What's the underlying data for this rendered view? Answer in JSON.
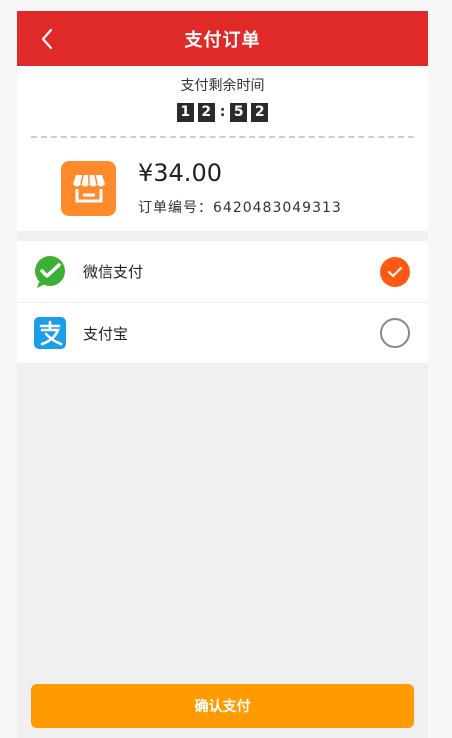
{
  "navbar": {
    "title": "支付订单",
    "back_icon": "back-icon"
  },
  "countdown": {
    "label": "支付剩余时间",
    "digits": [
      "1",
      "2",
      "5",
      "2"
    ],
    "separator": ":"
  },
  "order": {
    "price": "¥34.00",
    "order_number": "订单编号：6420483049313",
    "icon": "store-icon"
  },
  "payment_methods": [
    {
      "label": "微信支付",
      "icon": "wechat-pay-icon",
      "selected": true
    },
    {
      "label": "支付宝",
      "icon": "alipay-icon",
      "selected": false
    }
  ],
  "confirm_button": {
    "label": "确认支付"
  },
  "colors": {
    "navbar": "#e02a2a",
    "store_icon": "#ff8a2b",
    "selected_radio": "#ff5a14",
    "confirm_button": "#ff9a00",
    "wechat": "#3cb034",
    "alipay": "#1a9ee8"
  }
}
